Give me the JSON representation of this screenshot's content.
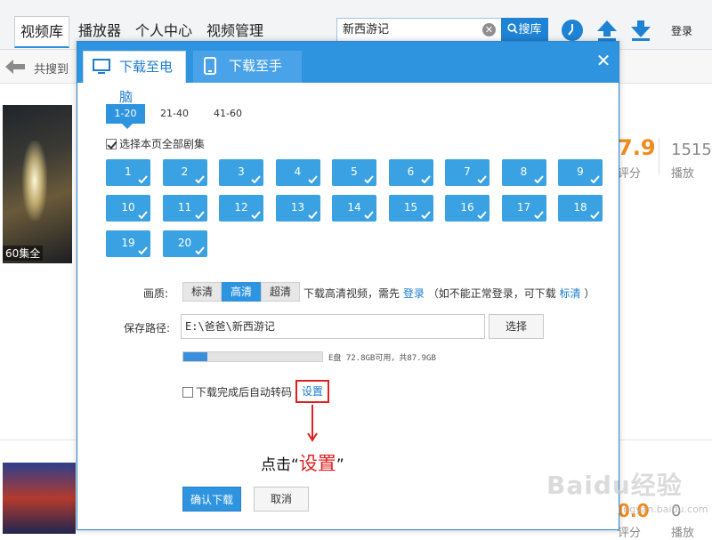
{
  "topbar": {
    "tabs": [
      {
        "label": "视频库",
        "active": true
      },
      {
        "label": "播放器",
        "active": false
      },
      {
        "label": "个人中心",
        "active": false
      },
      {
        "label": "视频管理",
        "active": false
      }
    ],
    "search_value": "新西游记",
    "search_button": "搜库",
    "login": "登录",
    "icons": [
      "clock-icon",
      "upload-icon",
      "download-icon"
    ]
  },
  "subbar": {
    "result_text": "共搜到"
  },
  "results": {
    "first": {
      "caption": "60集全",
      "score": "7.9",
      "score_label": "评分",
      "plays": "1515",
      "plays_label": "播放"
    },
    "second": {
      "score": "0.0",
      "score_label": "评分",
      "plays": "0",
      "plays_label": "播放"
    }
  },
  "dialog": {
    "tabs": [
      {
        "label": "下载至电脑",
        "active": true
      },
      {
        "label": "下载至手机",
        "active": false
      }
    ],
    "close": "✕",
    "ranges": [
      "1-20",
      "21-40",
      "41-60"
    ],
    "select_all": "选择本页全部剧集",
    "episodes": [
      "1",
      "2",
      "3",
      "4",
      "5",
      "6",
      "7",
      "8",
      "9",
      "10",
      "11",
      "12",
      "13",
      "14",
      "15",
      "16",
      "17",
      "18",
      "19",
      "20"
    ],
    "quality": {
      "label": "画质:",
      "options": [
        "标清",
        "高清",
        "超清"
      ],
      "selected": "高清",
      "hint_prefix": "下载高清视频，需先",
      "hint_login": "登录",
      "hint_middle": "（如不能正常登录，可下载",
      "hint_sd": "标清",
      "hint_suffix": "）"
    },
    "path": {
      "label": "保存路径:",
      "value": "E:\\爸爸\\新西游记",
      "choose": "选择"
    },
    "disk": {
      "text": "E盘 72.8GB可用，共87.9GB",
      "used_fraction": 0.17
    },
    "auto_transcode": "下载完成后自动转码",
    "settings": "设置",
    "annotation_prefix": "点击“",
    "annotation_highlight": "设置",
    "annotation_suffix": "”",
    "confirm": "确认下载",
    "cancel": "取消"
  },
  "watermark": {
    "main": "Baidu经验",
    "sub": "jingyan.baidu.com"
  },
  "colors": {
    "accent": "#2f94e0",
    "annotation": "#e02020",
    "score": "#f08a1c"
  }
}
